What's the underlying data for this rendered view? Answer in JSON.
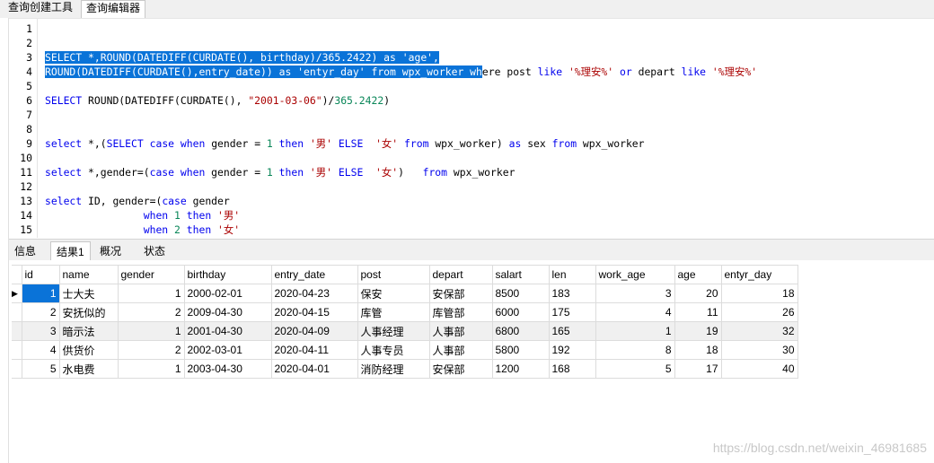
{
  "top_tabs": [
    {
      "label": "查询创建工具"
    },
    {
      "label": "查询编辑器"
    }
  ],
  "editor": {
    "lines": [
      {
        "num": "1",
        "html": ""
      },
      {
        "num": "2",
        "html": ""
      },
      {
        "num": "3",
        "html": "<span class=\"sel\">SELECT *,ROUND(DATEDIFF(CURDATE(), birthday)/365.2422) as 'age',</span>"
      },
      {
        "num": "4",
        "html": "<span class=\"sel\">ROUND(DATEDIFF(CURDATE(),entry_date)) as 'entyr_day' from wpx_worker wh</span>ere post <span class=\"kw\">like</span> <span class=\"str\">'%理安%'</span> <span class=\"kw\">or</span> depart <span class=\"kw\">like</span> <span class=\"str\">'%理安%'</span>"
      },
      {
        "num": "5",
        "html": ""
      },
      {
        "num": "6",
        "html": "<span class=\"kw\">SELECT</span> ROUND(DATEDIFF(CURDATE(), <span class=\"str\">\"2001-03-06\"</span>)/<span class=\"num\">365.2422</span>)"
      },
      {
        "num": "7",
        "html": ""
      },
      {
        "num": "8",
        "html": ""
      },
      {
        "num": "9",
        "html": "<span class=\"kw\">select</span> *,(<span class=\"kw\">SELECT</span> <span class=\"kw\">case</span> <span class=\"kw\">when</span> gender = <span class=\"num\">1</span> <span class=\"kw\">then</span> <span class=\"str\">'男'</span> <span class=\"kw\">ELSE</span>  <span class=\"str\">'女'</span> <span class=\"kw\">from</span> wpx_worker) <span class=\"kw\">as</span> sex <span class=\"kw\">from</span> wpx_worker"
      },
      {
        "num": "10",
        "html": ""
      },
      {
        "num": "11",
        "html": "<span class=\"kw\">select</span> *,gender=(<span class=\"kw\">case</span> <span class=\"kw\">when</span> gender = <span class=\"num\">1</span> <span class=\"kw\">then</span> <span class=\"str\">'男'</span> <span class=\"kw\">ELSE</span>  <span class=\"str\">'女'</span>)   <span class=\"kw\">from</span> wpx_worker"
      },
      {
        "num": "12",
        "html": ""
      },
      {
        "num": "13",
        "html": "<span class=\"kw\">select</span> ID, gender=(<span class=\"kw\">case</span> gender"
      },
      {
        "num": "14",
        "html": "                <span class=\"kw\">when</span> <span class=\"num\">1</span> <span class=\"kw\">then</span> <span class=\"str\">'男'</span>"
      },
      {
        "num": "15",
        "html": "                <span class=\"kw\">when</span> <span class=\"num\">2</span> <span class=\"kw\">then</span> <span class=\"str\">'女'</span>"
      }
    ]
  },
  "bottom_tabs": [
    {
      "label": "信息"
    },
    {
      "label": "结果1"
    },
    {
      "label": "概况"
    },
    {
      "label": "状态"
    }
  ],
  "grid": {
    "columns": [
      "id",
      "name",
      "gender",
      "birthday",
      "entry_date",
      "post",
      "depart",
      "salart",
      "len",
      "work_age",
      "age",
      "entyr_day"
    ],
    "rows": [
      [
        "1",
        "士大夫",
        "1",
        "2000-02-01",
        "2020-04-23",
        "保安",
        "安保部",
        "8500",
        "183",
        "3",
        "20",
        "18"
      ],
      [
        "2",
        "安抚似的",
        "2",
        "2009-04-30",
        "2020-04-15",
        "库管",
        "库管部",
        "6000",
        "175",
        "4",
        "11",
        "26"
      ],
      [
        "3",
        "暗示法",
        "1",
        "2001-04-30",
        "2020-04-09",
        "人事经理",
        "人事部",
        "6800",
        "165",
        "1",
        "19",
        "32"
      ],
      [
        "4",
        "供货价",
        "2",
        "2002-03-01",
        "2020-04-11",
        "人事专员",
        "人事部",
        "5800",
        "192",
        "8",
        "18",
        "30"
      ],
      [
        "5",
        "水电费",
        "1",
        "2003-04-30",
        "2020-04-01",
        "消防经理",
        "安保部",
        "1200",
        "168",
        "5",
        "17",
        "40"
      ]
    ]
  },
  "watermark": "https://blog.csdn.net/weixin_46981685",
  "colors": {
    "selection": "#0a73d8",
    "keyword": "#0000ee",
    "string": "#aa0000",
    "number": "#098658"
  }
}
